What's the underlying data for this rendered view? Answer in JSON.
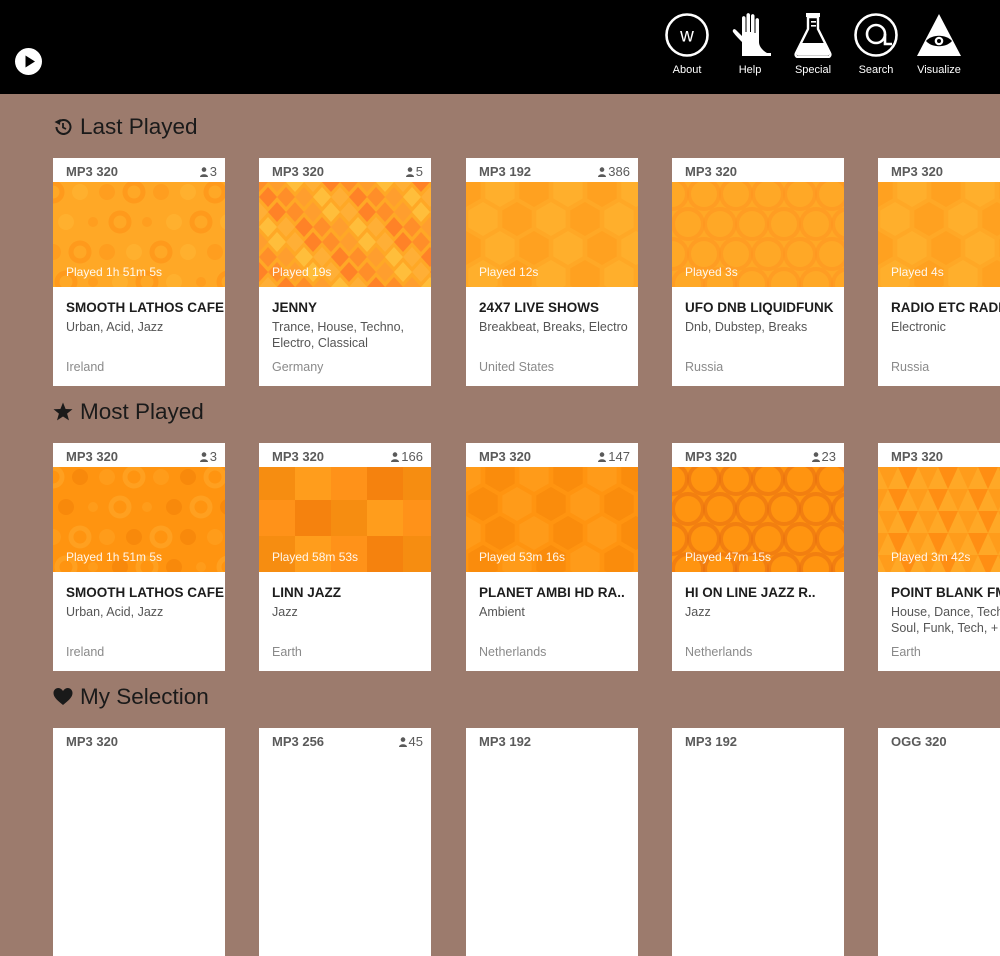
{
  "nav": {
    "items": [
      {
        "label": "About",
        "icon": "about-w-icon"
      },
      {
        "label": "Help",
        "icon": "help-hand-icon"
      },
      {
        "label": "Special",
        "icon": "special-flask-icon"
      },
      {
        "label": "Search",
        "icon": "search-at-icon"
      },
      {
        "label": "Visualize",
        "icon": "visualize-eye-icon"
      }
    ]
  },
  "colors": {
    "background": "#9c7b6d",
    "topbar": "#000000",
    "accent": "#ffa31c"
  },
  "sections": [
    {
      "title": "Last Played",
      "icon": "history-icon",
      "cards": [
        {
          "bitrate": "MP3 320",
          "listeners": "3",
          "played": "Played 1h 51m 5s",
          "name": "SMOOTH LATHOS CAFE",
          "genre": "Urban, Acid, Jazz",
          "country": "Ireland",
          "pattern": "circles"
        },
        {
          "bitrate": "MP3 320",
          "listeners": "5",
          "played": "Played 19s",
          "name": "JENNY",
          "genre": "Trance, House, Techno, Electro, Classical",
          "country": "Germany",
          "pattern": "diamonds"
        },
        {
          "bitrate": "MP3 192",
          "listeners": "386",
          "played": "Played 12s",
          "name": "24X7 LIVE SHOWS",
          "genre": "Breakbeat, Breaks, Electro",
          "country": "United States",
          "pattern": "hexagons"
        },
        {
          "bitrate": "MP3 320",
          "listeners": "",
          "played": "Played 3s",
          "name": "UFO DNB LIQUIDFUNK",
          "genre": "Dnb, Dubstep, Breaks",
          "country": "Russia",
          "pattern": "rings"
        },
        {
          "bitrate": "MP3 320",
          "listeners": "",
          "played": "Played 4s",
          "name": "RADIO ETC RADIO",
          "genre": "Electronic",
          "country": "Russia",
          "pattern": "hexagons"
        }
      ]
    },
    {
      "title": "Most Played",
      "icon": "star-icon",
      "cards": [
        {
          "bitrate": "MP3 320",
          "listeners": "3",
          "played": "Played 1h 51m 5s",
          "name": "SMOOTH LATHOS CAFE",
          "genre": "Urban, Acid, Jazz",
          "country": "Ireland",
          "pattern": "circles-dark"
        },
        {
          "bitrate": "MP3 320",
          "listeners": "166",
          "played": "Played 58m 53s",
          "name": "LINN JAZZ",
          "genre": "Jazz",
          "country": "Earth",
          "pattern": "squares"
        },
        {
          "bitrate": "MP3 320",
          "listeners": "147",
          "played": "Played 53m 16s",
          "name": "PLANET AMBI HD RA..",
          "genre": "Ambient",
          "country": "Netherlands",
          "pattern": "hexagons-dark"
        },
        {
          "bitrate": "MP3 320",
          "listeners": "23",
          "played": "Played 47m 15s",
          "name": "HI ON LINE JAZZ R..",
          "genre": "Jazz",
          "country": "Netherlands",
          "pattern": "rings-dark"
        },
        {
          "bitrate": "MP3 320",
          "listeners": "",
          "played": "Played 3m 42s",
          "name": "POINT BLANK FM",
          "genre": "House, Dance, Techno, Soul, Funk, Tech, +",
          "country": "Earth",
          "pattern": "triangles"
        }
      ]
    },
    {
      "title": "My Selection",
      "icon": "heart-icon",
      "cards": [
        {
          "bitrate": "MP3 320",
          "listeners": ""
        },
        {
          "bitrate": "MP3 256",
          "listeners": "45"
        },
        {
          "bitrate": "MP3 192",
          "listeners": ""
        },
        {
          "bitrate": "MP3 192",
          "listeners": ""
        },
        {
          "bitrate": "OGG 320",
          "listeners": ""
        }
      ]
    }
  ]
}
